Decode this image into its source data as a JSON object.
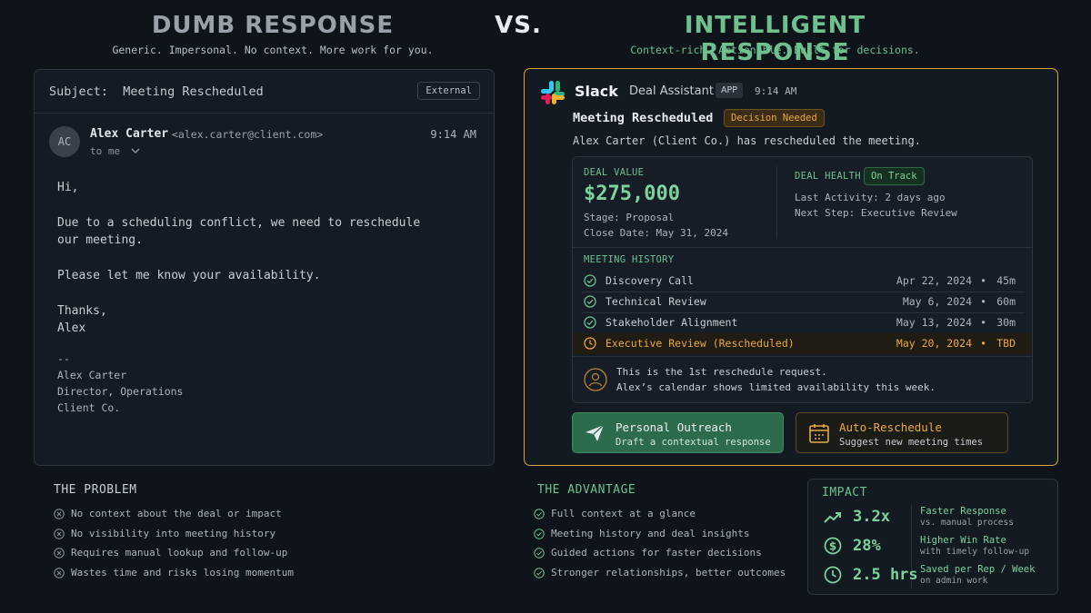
{
  "headers": {
    "left_title": "DUMB RESPONSE",
    "left_subtitle": "Generic. Impersonal. No context. More work for you.",
    "vs": "VS.",
    "right_title": "INTELLIGENT RESPONSE",
    "right_subtitle": "Context-rich. Actionable. Built for decisions."
  },
  "colors": {
    "background": "#0f141b",
    "accent_green": "#7ed39c",
    "accent_gold": "#d8a43e",
    "muted_gray": "#8f96a0"
  },
  "email": {
    "subject_label": "Subject:",
    "subject": "Meeting Rescheduled",
    "external_badge": "External",
    "avatar_initials": "AC",
    "sender_name": "Alex Carter",
    "sender_email": "<alex.carter@client.com>",
    "time": "9:14 AM",
    "to": "to me",
    "body": [
      "Hi,",
      "Due to a scheduling conflict, we need to reschedule",
      "our meeting.",
      "Please let me know your availability.",
      "Thanks,",
      "Alex"
    ],
    "signature": [
      "--",
      "Alex Carter",
      "Director, Operations",
      "Client Co."
    ]
  },
  "slack": {
    "app_name": "Slack",
    "bot_name": "Deal Assistant",
    "app_badge": "APP",
    "time": "9:14 AM",
    "title": "Meeting Rescheduled",
    "decision_badge": "Decision Needed",
    "message": "Alex Carter (Client Co.) has rescheduled the meeting.",
    "deal": {
      "value_label": "DEAL VALUE",
      "value": "$275,000",
      "stage": "Stage: Proposal",
      "close_date": "Close Date: May 31, 2024",
      "health_label": "DEAL HEALTH",
      "health_status": "On Track",
      "last_activity": "Last Activity: 2 days ago",
      "next_step": "Next Step: Executive Review"
    },
    "history_label": "MEETING HISTORY",
    "meetings": [
      {
        "name": "Discovery Call",
        "date": "Apr 22, 2024",
        "bullet": "•",
        "duration": "45m",
        "status": "done"
      },
      {
        "name": "Technical Review",
        "date": "May 6, 2024",
        "bullet": "•",
        "duration": "60m",
        "status": "done"
      },
      {
        "name": "Stakeholder Alignment",
        "date": "May 13, 2024",
        "bullet": "•",
        "duration": "30m",
        "status": "done"
      },
      {
        "name": "Executive Review (Rescheduled)",
        "date": "May 20, 2024",
        "bullet": "•",
        "duration": "TBD",
        "status": "pending"
      }
    ],
    "notes": [
      "This is the 1st reschedule request.",
      "Alex’s calendar shows limited availability this week."
    ],
    "actions": {
      "primary_title": "Personal Outreach",
      "primary_sub": "Draft a contextual response",
      "secondary_title": "Auto-Reschedule",
      "secondary_sub": "Suggest new meeting times"
    }
  },
  "problem": {
    "title": "THE PROBLEM",
    "items": [
      "No context about the deal or impact",
      "No visibility into meeting history",
      "Requires manual lookup and follow-up",
      "Wastes time and risks losing momentum"
    ]
  },
  "advantage": {
    "title": "THE ADVANTAGE",
    "items": [
      "Full context at a glance",
      "Meeting history and deal insights",
      "Guided actions for faster decisions",
      "Stronger relationships, better outcomes"
    ]
  },
  "impact": {
    "title": "IMPACT",
    "metrics": [
      {
        "value": "3.2x",
        "label": "Faster Response",
        "sub": "vs. manual process",
        "icon": "trend-up-icon"
      },
      {
        "value": "28%",
        "label": "Higher Win Rate",
        "sub": "with timely follow-up",
        "icon": "dollar-icon"
      },
      {
        "value": "2.5 hrs",
        "label": "Saved per Rep / Week",
        "sub": "on admin work",
        "icon": "clock-icon"
      }
    ]
  }
}
